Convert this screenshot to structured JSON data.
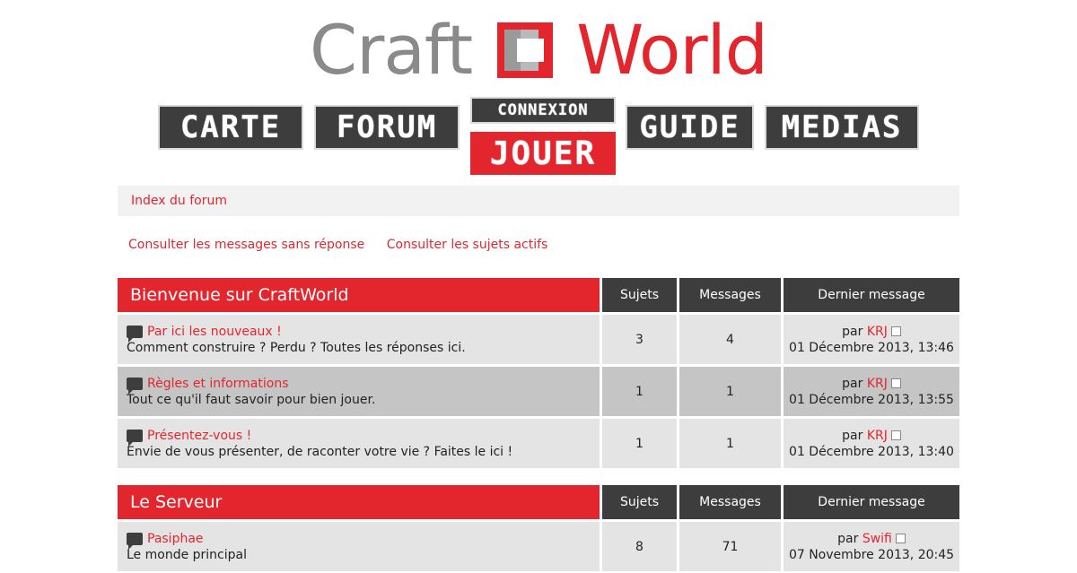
{
  "logo": {
    "craft": "Craft",
    "world": "World"
  },
  "nav": {
    "carte": "CARTE",
    "forum": "FORUM",
    "connexion": "CONNEXION",
    "jouer": "JOUER",
    "guide": "GUIDE",
    "medias": "MEDIAS"
  },
  "breadcrumb": {
    "label": "Index du forum"
  },
  "quicklinks": {
    "unanswered": "Consulter les messages sans réponse",
    "active": "Consulter les sujets actifs"
  },
  "columns": {
    "topics": "Sujets",
    "posts": "Messages",
    "last": "Dernier message"
  },
  "categories": [
    {
      "title": "Bienvenue sur CraftWorld",
      "forums": [
        {
          "name": "Par ici les nouveaux !",
          "desc": "Comment construire ? Perdu ? Toutes les réponses ici.",
          "topics": "3",
          "posts": "4",
          "by": "par",
          "author": "KRJ",
          "date": "01 Décembre 2013, 13:46"
        },
        {
          "name": "Règles et informations",
          "desc": "Tout ce qu'il faut savoir pour bien jouer.",
          "topics": "1",
          "posts": "1",
          "by": "par",
          "author": "KRJ",
          "date": "01 Décembre 2013, 13:55"
        },
        {
          "name": "Présentez-vous !",
          "desc": "Envie de vous présenter, de raconter votre vie ? Faites le ici !",
          "topics": "1",
          "posts": "1",
          "by": "par",
          "author": "KRJ",
          "date": "01 Décembre 2013, 13:40"
        }
      ]
    },
    {
      "title": "Le Serveur",
      "forums": [
        {
          "name": "Pasiphae",
          "desc": "Le monde principal",
          "topics": "8",
          "posts": "71",
          "by": "par",
          "author": "Swifi",
          "date": "07 Novembre 2013, 20:45"
        }
      ]
    }
  ],
  "colors": {
    "accent": "#e3262e",
    "dark": "#3d3d3d",
    "row": "#e4e4e4",
    "row_alt": "#c5c5c5"
  }
}
